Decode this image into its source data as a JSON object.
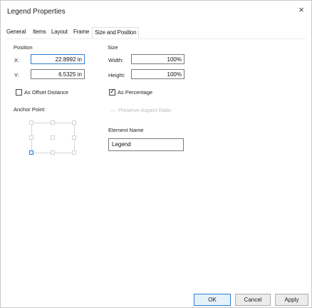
{
  "window": {
    "title": "Legend Properties",
    "close_glyph": "×"
  },
  "tabs": [
    {
      "label": "General"
    },
    {
      "label": "Items"
    },
    {
      "label": "Layout"
    },
    {
      "label": "Frame"
    },
    {
      "label": "Size and Position",
      "active": true
    }
  ],
  "position": {
    "heading": "Position",
    "x_label": "X:",
    "x_value": "22.8992 in",
    "y_label": "Y:",
    "y_value": "6.5325 in"
  },
  "size": {
    "heading": "Size",
    "width_label": "Width:",
    "width_value": "100%",
    "height_label": "Height:",
    "height_value": "100%"
  },
  "options": {
    "as_offset_distance": {
      "label": "As Offset Distance",
      "checked": false
    },
    "as_percentage": {
      "label": "As Percentage",
      "checked": true
    },
    "preserve_aspect_ratio": {
      "label": "Preserve Aspect Ratio",
      "checked": false,
      "enabled": false
    }
  },
  "anchor_point": {
    "label": "Anchor Point:",
    "selected": "bottom-left"
  },
  "element_name": {
    "label": "Element Name",
    "value": "Legend"
  },
  "buttons": {
    "ok": "OK",
    "cancel": "Cancel",
    "apply": "Apply"
  },
  "colors": {
    "accent": "#2a7fd4",
    "border": "#7a7a7a"
  }
}
